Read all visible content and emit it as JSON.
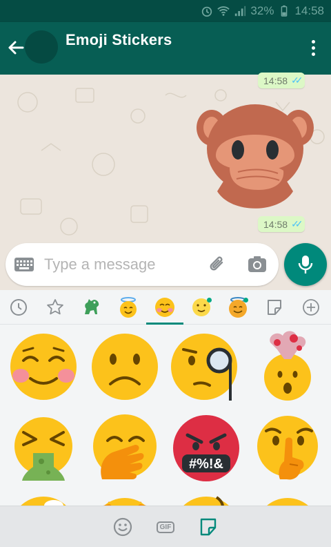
{
  "status_bar": {
    "battery": "32%",
    "time": "14:58"
  },
  "header": {
    "title": "Emoji Stickers"
  },
  "messages": [
    {
      "time": "14:58"
    },
    {
      "time": "14:58"
    }
  ],
  "composer": {
    "placeholder": "Type a message"
  },
  "sticker_tabs": [
    {
      "name": "recent-icon"
    },
    {
      "name": "favorites-star-icon"
    },
    {
      "name": "dinosaur-pack-icon"
    },
    {
      "name": "angel-face-pack-icon"
    },
    {
      "name": "smiling-face-pack-icon",
      "active": true
    },
    {
      "name": "slight-smile-pack-icon",
      "new": true
    },
    {
      "name": "angel-smile-pack-icon",
      "new": true
    },
    {
      "name": "sticker-store-icon"
    },
    {
      "name": "add-pack-icon"
    }
  ],
  "stickers_visible": [
    "smiling-blushing-face",
    "frowning-face",
    "face-with-monocle",
    "exploding-head",
    "vomiting-face",
    "face-with-hand-over-mouth",
    "face-with-symbols-on-mouth",
    "shushing-face"
  ],
  "symbols_text": "#%!&",
  "bottom_bar": {
    "gif_label": "GIF"
  },
  "colors": {
    "header": "#075e54",
    "accent": "#00897b",
    "bubble": "#dcf8c6",
    "emoji": "#fcc21b"
  }
}
